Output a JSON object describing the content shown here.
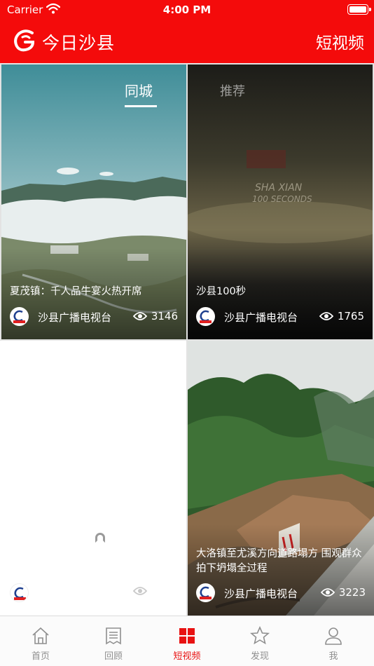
{
  "status_bar": {
    "carrier": "Carrier",
    "time": "4:00 PM"
  },
  "header": {
    "app_title": "今日沙县",
    "section": "短视频"
  },
  "feed_tabs": {
    "local": "同城",
    "recommended": "推荐"
  },
  "videos": [
    {
      "title": "夏茂镇：千人品牛宴火热开席",
      "source": "沙县广播电视台",
      "views": "3146"
    },
    {
      "title": "沙县100秒",
      "source": "沙县广播电视台",
      "views": "1765",
      "overlay_line1": "SHA XIAN",
      "overlay_line2": "100 SECONDS"
    },
    {
      "title": "",
      "source": "",
      "views": ""
    },
    {
      "title": "大洛镇至尤溪方向道路塌方 围观群众拍下坍塌全过程",
      "source": "沙县广播电视台",
      "views": "3223"
    }
  ],
  "tab_bar": [
    {
      "label": "首页",
      "icon": "home-icon"
    },
    {
      "label": "回顾",
      "icon": "receipt-icon"
    },
    {
      "label": "短视频",
      "icon": "grid-icon",
      "active": true
    },
    {
      "label": "发现",
      "icon": "star-icon"
    },
    {
      "label": "我",
      "icon": "person-icon"
    }
  ],
  "colors": {
    "brand_red": "#f40b0b",
    "active_tab": "#e81212",
    "inactive_tab": "#8f8f8f"
  }
}
